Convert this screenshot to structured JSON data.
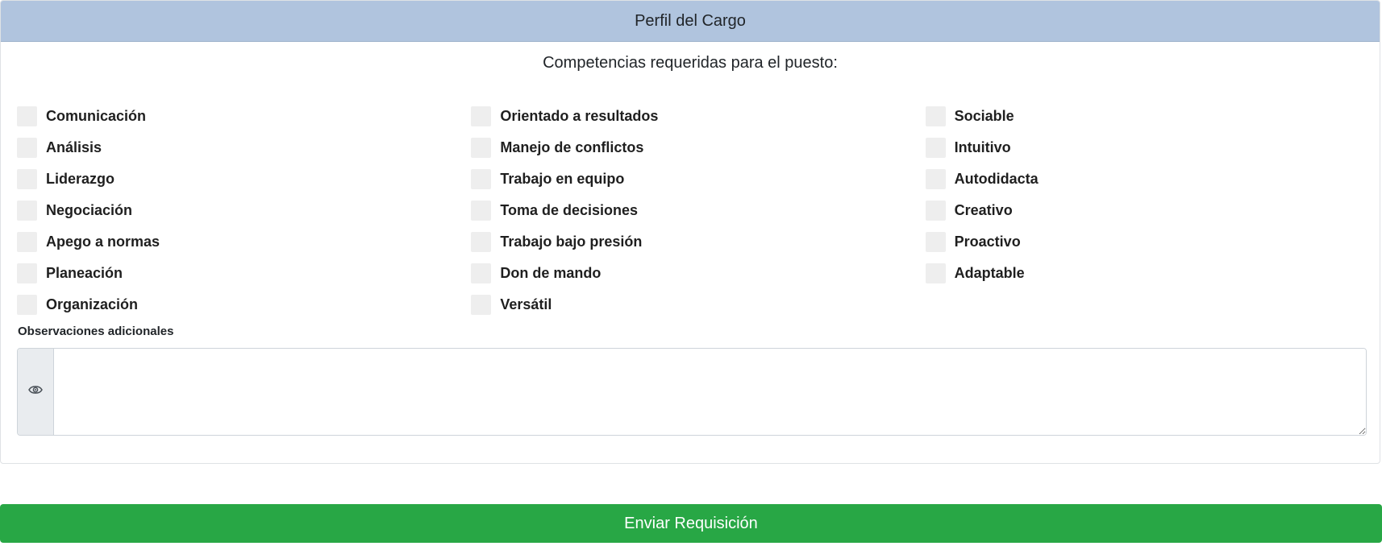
{
  "card": {
    "title": "Perfil del Cargo",
    "subtitle": "Competencias requeridas para el puesto:"
  },
  "competencias": {
    "col1": [
      "Comunicación",
      "Análisis",
      "Liderazgo",
      "Negociación",
      "Apego a normas",
      "Planeación",
      "Organización"
    ],
    "col2": [
      "Orientado a resultados",
      "Manejo de conflictos",
      "Trabajo en equipo",
      "Toma de decisiones",
      "Trabajo bajo presión",
      "Don de mando",
      "Versátil"
    ],
    "col3": [
      "Sociable",
      "Intuitivo",
      "Autodidacta",
      "Creativo",
      "Proactivo",
      "Adaptable"
    ]
  },
  "observaciones": {
    "label": "Observaciones adicionales",
    "icon": "eye-icon",
    "value": ""
  },
  "submit_label": "Enviar Requisición",
  "colors": {
    "header_bg": "#b0c4de",
    "submit_bg": "#28a745",
    "checkbox_bg": "#eeeeee"
  }
}
